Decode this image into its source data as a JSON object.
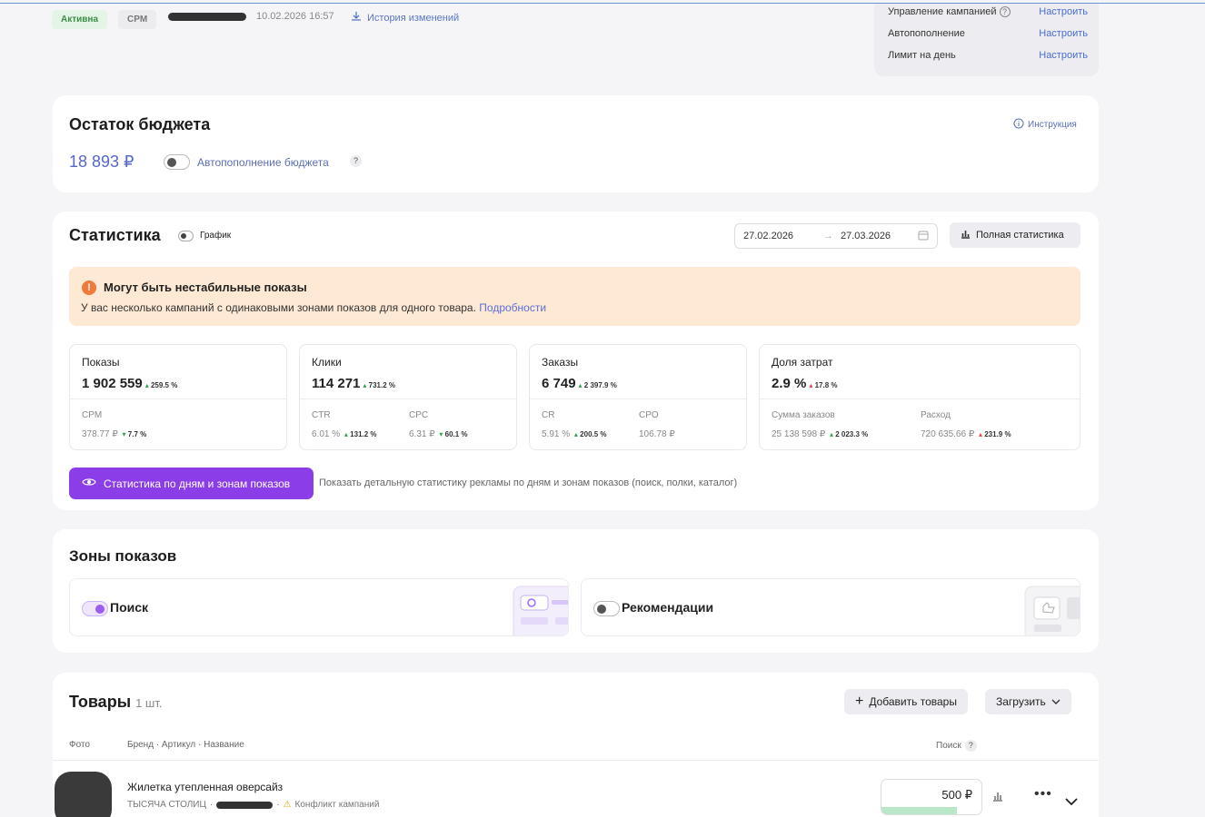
{
  "header": {
    "status_badge": "Активна",
    "type_badge": "CPM",
    "datetime": "10.02.2026 16:57",
    "history_link": "История изменений",
    "management": [
      {
        "label": "Управление кампанией",
        "action": "Настроить"
      },
      {
        "label": "Автопополнение",
        "action": "Настроить"
      },
      {
        "label": "Лимит на день",
        "action": "Настроить"
      }
    ]
  },
  "budget": {
    "title": "Остаток бюджета",
    "instruction_link": "Инструкция",
    "amount": "18 893 ₽",
    "autofill_label": "Автопополнение бюджета",
    "help": "?"
  },
  "stats": {
    "title": "Статистика",
    "chart_toggle_label": "График",
    "date_from": "27.02.2026",
    "date_to": "27.03.2026",
    "full_stats_button": "Полная статистика",
    "alert_title": "Могут быть нестабильные показы",
    "alert_text": "У вас несколько кампаний с одинаковыми зонами показов для одного товара.",
    "alert_link": "Подробности",
    "metrics": [
      {
        "label": "Показы",
        "value": "1 902 559",
        "delta": "259.5 %",
        "subs": [
          {
            "label": "CPM",
            "value": "378.77 ₽",
            "arrow": "▾",
            "delta": "7.7 %"
          }
        ]
      },
      {
        "label": "Клики",
        "value": "114 271",
        "delta": "731.2 %",
        "subs": [
          {
            "label": "CTR",
            "value": "6.01 %",
            "arrow": "▴",
            "delta": "131.2 %"
          },
          {
            "label": "CPC",
            "value": "6.31 ₽",
            "arrow": "▾",
            "delta": "60.1 %"
          }
        ]
      },
      {
        "label": "Заказы",
        "value": "6 749",
        "delta": "2 397.9 %",
        "subs": [
          {
            "label": "CR",
            "value": "5.91 %",
            "arrow": "▴",
            "delta": "200.5 %"
          },
          {
            "label": "CPO",
            "value": "106.78 ₽",
            "arrow": "",
            "delta": ""
          }
        ]
      },
      {
        "label": "Доля затрат",
        "value": "2.9 %",
        "delta": "17.8 %",
        "subs": [
          {
            "label": "Сумма заказов",
            "value": "25 138 598 ₽",
            "arrow": "▴",
            "delta": "2 023.3 %"
          },
          {
            "label": "Расход",
            "value": "720 635.66 ₽",
            "arrow": "▴",
            "delta": "231.9 %"
          }
        ]
      }
    ],
    "daily_button": "Статистика по дням и зонам показов",
    "daily_hint": "Показать детальную статистику рекламы по дням и зонам показов (поиск, полки, каталог)"
  },
  "zones": {
    "title": "Зоны показов",
    "items": [
      {
        "label": "Поиск",
        "enabled": true
      },
      {
        "label": "Рекомендации",
        "enabled": false
      }
    ]
  },
  "products": {
    "title": "Товары",
    "count": "1 шт.",
    "add_button": "Добавить товары",
    "load_button": "Загрузить",
    "col_photo": "Фото",
    "col_name": "Бренд · Артикул · Название",
    "col_search": "Поиск",
    "help": "?",
    "rows": [
      {
        "name": "Жилетка утепленная оверсайз",
        "brand": "ТЫСЯЧА СТОЛИЦ",
        "conflict": "Конфликт кампаний",
        "bid": "500 ₽",
        "bid_fill": 0.75
      }
    ]
  }
}
